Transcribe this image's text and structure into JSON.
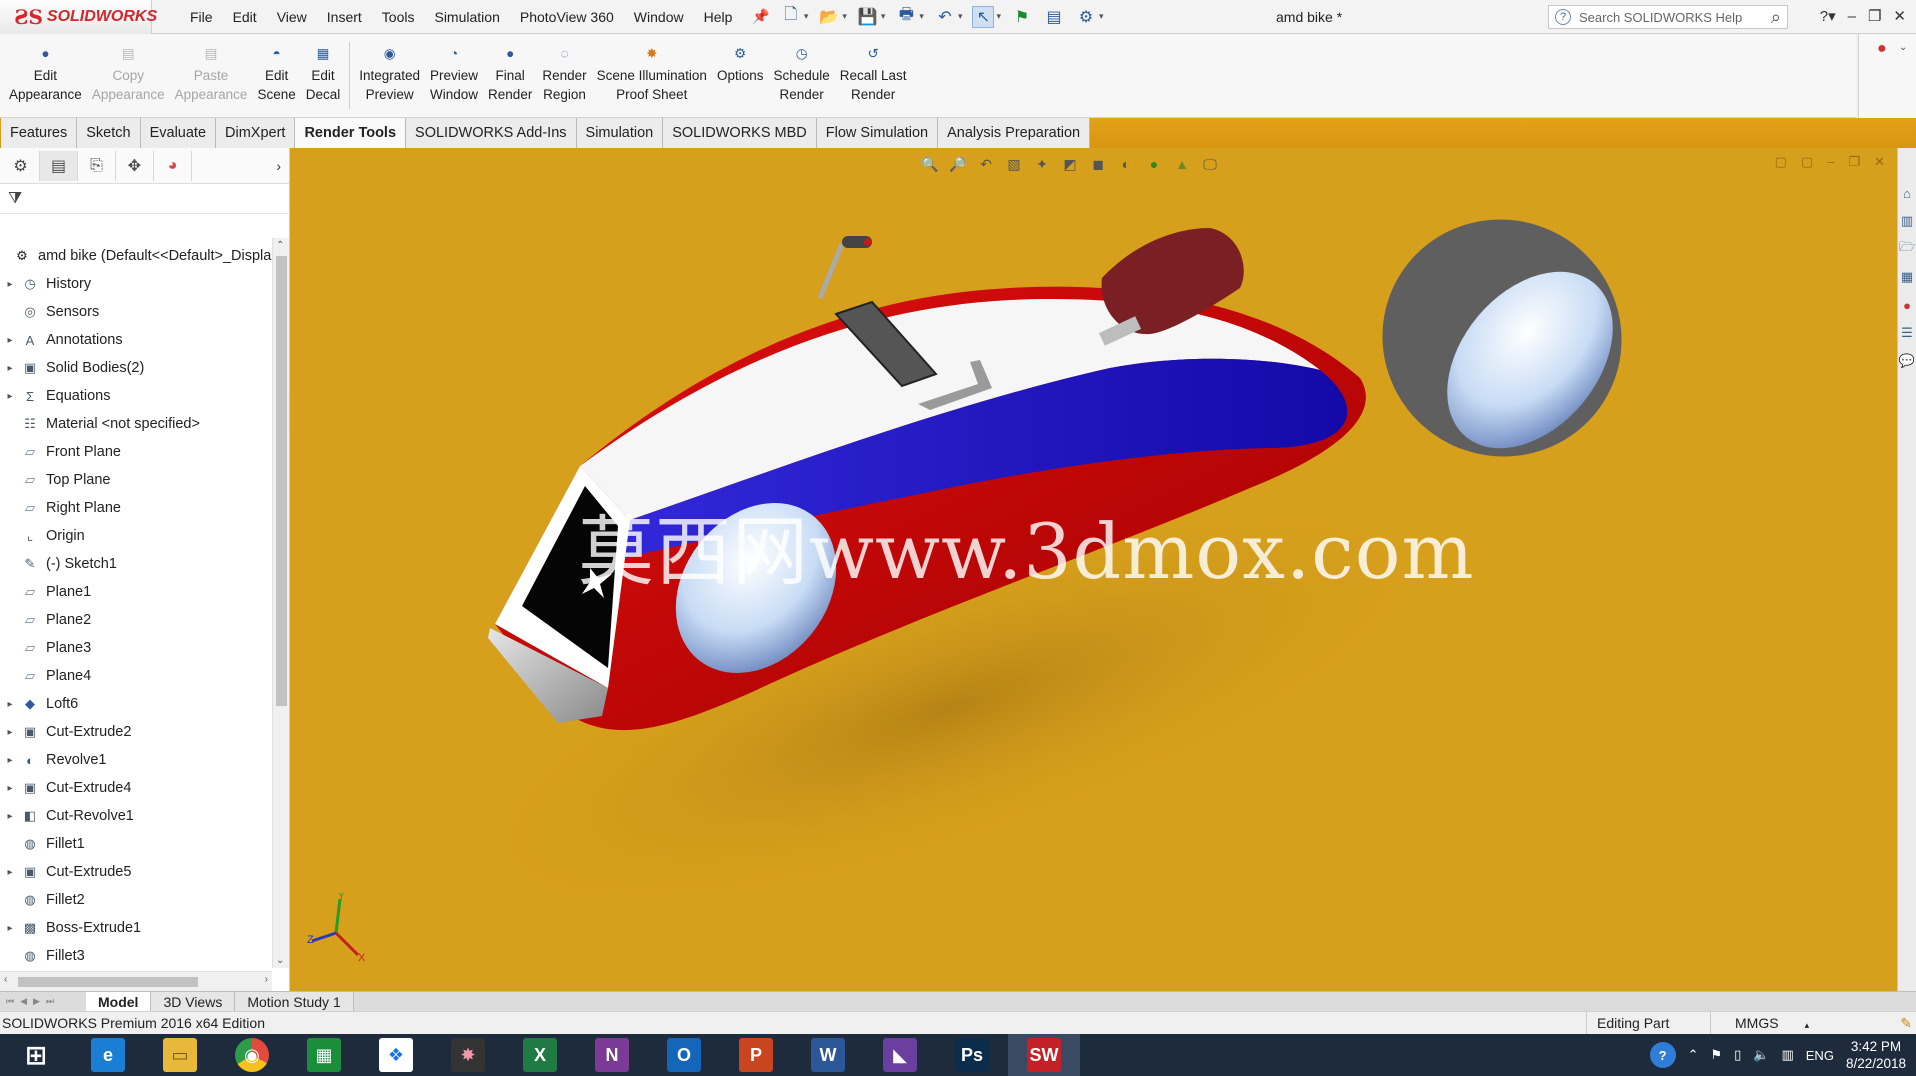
{
  "app": {
    "logo_text": "SOLIDWORKS",
    "menu": [
      "File",
      "Edit",
      "View",
      "Insert",
      "Tools",
      "Simulation",
      "PhotoView 360",
      "Window",
      "Help"
    ],
    "doc_title": "amd bike *",
    "search_placeholder": "Search SOLIDWORKS Help"
  },
  "ribbon": {
    "buttons": [
      {
        "line1": "Edit",
        "line2": "Appearance",
        "enabled": true,
        "icon": "edit-appearance-icon"
      },
      {
        "line1": "Copy",
        "line2": "Appearance",
        "enabled": false,
        "icon": "copy-appearance-icon"
      },
      {
        "line1": "Paste",
        "line2": "Appearance",
        "enabled": false,
        "icon": "paste-appearance-icon"
      },
      {
        "line1": "Edit",
        "line2": "Scene",
        "enabled": true,
        "icon": "edit-scene-icon"
      },
      {
        "line1": "Edit",
        "line2": "Decal",
        "enabled": true,
        "icon": "edit-decal-icon"
      },
      {
        "line1": "Integrated",
        "line2": "Preview",
        "enabled": true,
        "icon": "integrated-preview-icon"
      },
      {
        "line1": "Preview",
        "line2": "Window",
        "enabled": true,
        "icon": "preview-window-icon"
      },
      {
        "line1": "Final",
        "line2": "Render",
        "enabled": true,
        "icon": "final-render-icon"
      },
      {
        "line1": "Render",
        "line2": "Region",
        "enabled": true,
        "icon": "render-region-icon"
      },
      {
        "line1": "Scene Illumination",
        "line2": "Proof Sheet",
        "enabled": true,
        "icon": "scene-illumination-icon"
      },
      {
        "line1": "Options",
        "line2": "",
        "enabled": true,
        "icon": "options-icon"
      },
      {
        "line1": "Schedule",
        "line2": "Render",
        "enabled": true,
        "icon": "schedule-render-icon"
      },
      {
        "line1": "Recall Last",
        "line2": "Render",
        "enabled": true,
        "icon": "recall-last-render-icon"
      }
    ]
  },
  "tabs": [
    "Features",
    "Sketch",
    "Evaluate",
    "DimXpert",
    "Render Tools",
    "SOLIDWORKS Add-Ins",
    "Simulation",
    "SOLIDWORKS MBD",
    "Flow Simulation",
    "Analysis Preparation"
  ],
  "active_tab": "Render Tools",
  "feature_tree": {
    "root": "amd bike  (Default<<Default>_Displa",
    "items": [
      {
        "label": "History",
        "expandable": true,
        "icon": "history-icon"
      },
      {
        "label": "Sensors",
        "expandable": false,
        "icon": "sensors-icon"
      },
      {
        "label": "Annotations",
        "expandable": true,
        "icon": "annotations-icon"
      },
      {
        "label": "Solid Bodies(2)",
        "expandable": true,
        "icon": "solid-bodies-icon"
      },
      {
        "label": "Equations",
        "expandable": true,
        "icon": "equations-icon"
      },
      {
        "label": "Material <not specified>",
        "expandable": false,
        "icon": "material-icon"
      },
      {
        "label": "Front Plane",
        "expandable": false,
        "icon": "plane-icon"
      },
      {
        "label": "Top Plane",
        "expandable": false,
        "icon": "plane-icon"
      },
      {
        "label": "Right Plane",
        "expandable": false,
        "icon": "plane-icon"
      },
      {
        "label": "Origin",
        "expandable": false,
        "icon": "origin-icon"
      },
      {
        "label": "(-) Sketch1",
        "expandable": false,
        "icon": "sketch-icon"
      },
      {
        "label": "Plane1",
        "expandable": false,
        "icon": "plane-icon"
      },
      {
        "label": "Plane2",
        "expandable": false,
        "icon": "plane-icon"
      },
      {
        "label": "Plane3",
        "expandable": false,
        "icon": "plane-icon"
      },
      {
        "label": "Plane4",
        "expandable": false,
        "icon": "plane-icon"
      },
      {
        "label": "Loft6",
        "expandable": true,
        "icon": "loft-icon"
      },
      {
        "label": "Cut-Extrude2",
        "expandable": true,
        "icon": "cut-extrude-icon"
      },
      {
        "label": "Revolve1",
        "expandable": true,
        "icon": "revolve-icon"
      },
      {
        "label": "Cut-Extrude4",
        "expandable": true,
        "icon": "cut-extrude-icon"
      },
      {
        "label": "Cut-Revolve1",
        "expandable": true,
        "icon": "cut-revolve-icon"
      },
      {
        "label": "Fillet1",
        "expandable": false,
        "icon": "fillet-icon"
      },
      {
        "label": "Cut-Extrude5",
        "expandable": true,
        "icon": "cut-extrude-icon"
      },
      {
        "label": "Fillet2",
        "expandable": false,
        "icon": "fillet-icon"
      },
      {
        "label": "Boss-Extrude1",
        "expandable": true,
        "icon": "boss-extrude-icon"
      },
      {
        "label": "Fillet3",
        "expandable": false,
        "icon": "fillet-icon"
      }
    ]
  },
  "viewport": {
    "watermark": "莫西网www.3dmox.com",
    "background": "#d69f1c"
  },
  "bottom_tabs": [
    "Model",
    "3D Views",
    "Motion Study 1"
  ],
  "active_bottom_tab": "Model",
  "status": {
    "edition": "SOLIDWORKS Premium 2016 x64 Edition",
    "mode": "Editing Part",
    "units": "MMGS"
  },
  "taskbar": {
    "lang": "ENG",
    "time": "3:42 PM",
    "date": "8/22/2018",
    "apps": [
      {
        "name": "windows-start-icon",
        "label": "",
        "color": "#1e2b3d"
      },
      {
        "name": "internet-explorer-icon",
        "label": "e",
        "color": "#1a7fd4"
      },
      {
        "name": "file-explorer-icon",
        "label": "",
        "color": "#e8b83a"
      },
      {
        "name": "chrome-icon",
        "label": "",
        "color": "#e24a3b"
      },
      {
        "name": "store-icon",
        "label": "",
        "color": "#1b8e3c"
      },
      {
        "name": "dropbox-icon",
        "label": "",
        "color": "#ffffff"
      },
      {
        "name": "color-app-icon",
        "label": "",
        "color": "#333333"
      },
      {
        "name": "excel-icon",
        "label": "X",
        "color": "#1f7a44"
      },
      {
        "name": "onenote-icon",
        "label": "N",
        "color": "#7b3a96"
      },
      {
        "name": "outlook-icon",
        "label": "O",
        "color": "#1566b8"
      },
      {
        "name": "powerpoint-icon",
        "label": "P",
        "color": "#c9451f"
      },
      {
        "name": "word-icon",
        "label": "W",
        "color": "#2b5797"
      },
      {
        "name": "visual-studio-icon",
        "label": "",
        "color": "#6a3fa0"
      },
      {
        "name": "photoshop-icon",
        "label": "Ps",
        "color": "#0b2c4a"
      },
      {
        "name": "solidworks-icon",
        "label": "SW",
        "color": "#c42127"
      }
    ]
  }
}
